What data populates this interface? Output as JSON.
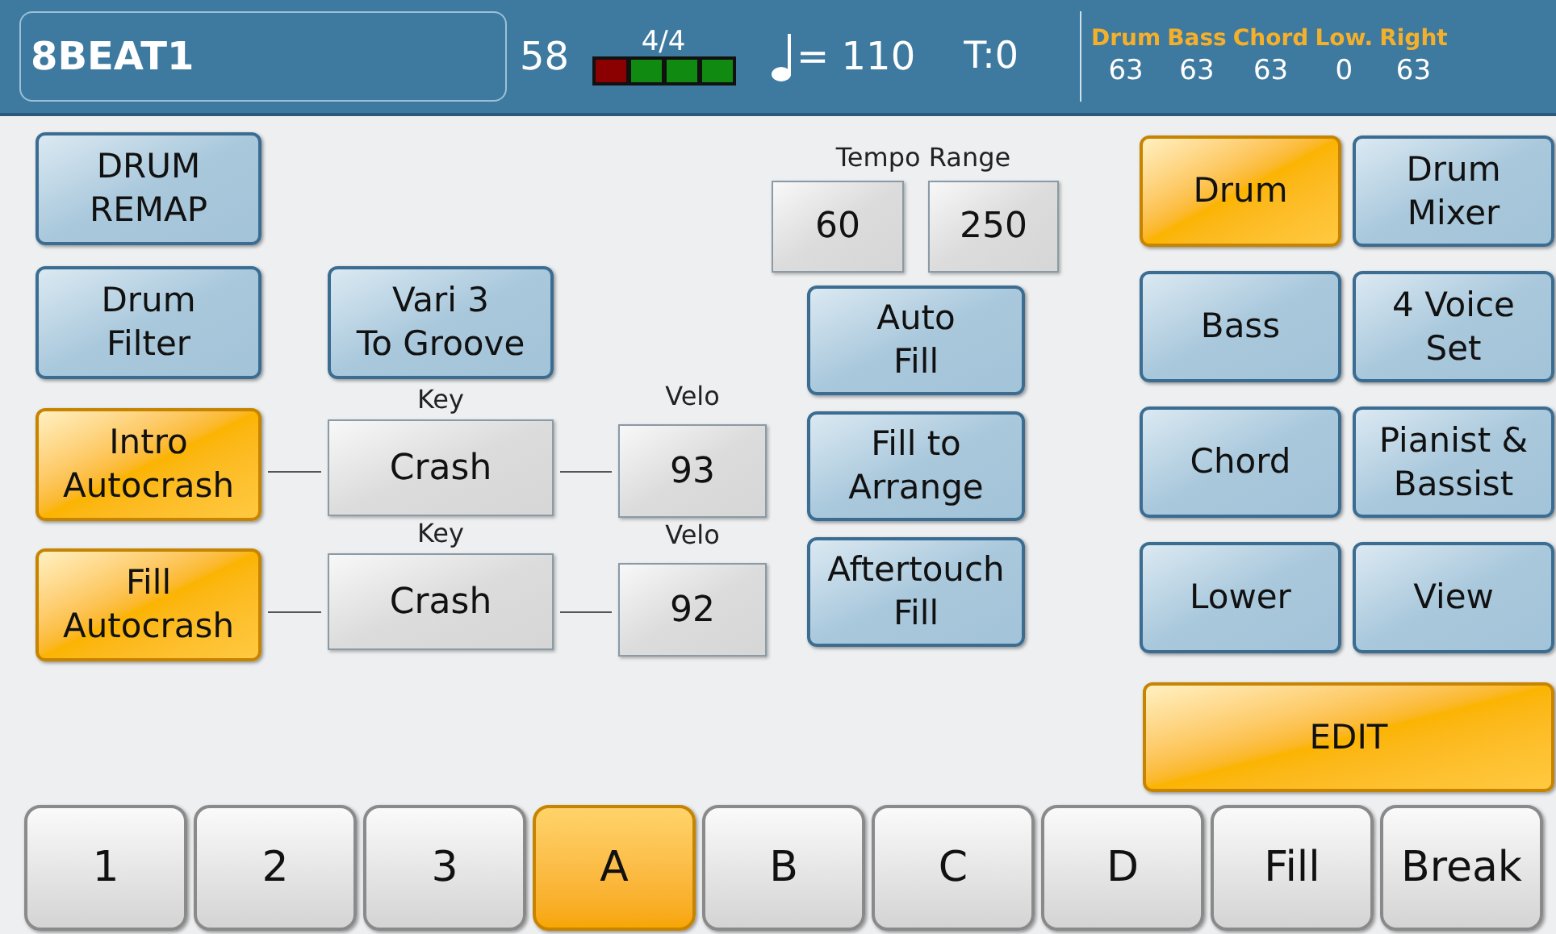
{
  "header": {
    "style_name": "8BEAT1",
    "measure": "58",
    "time_signature": "4/4",
    "beats": [
      {
        "color": "#8b0000"
      },
      {
        "color": "#118a11"
      },
      {
        "color": "#118a11"
      },
      {
        "color": "#118a11"
      }
    ],
    "tempo": "= 110",
    "transpose": "T:0",
    "parts": [
      {
        "label": "Drum",
        "value": "63"
      },
      {
        "label": "Bass",
        "value": "63"
      },
      {
        "label": "Chord",
        "value": "63"
      },
      {
        "label": "Low.",
        "value": "0"
      },
      {
        "label": "Right",
        "value": "63"
      }
    ]
  },
  "left_buttons": [
    {
      "label": "DRUM\nREMAP",
      "on": false
    },
    {
      "label": "Drum\nFilter",
      "on": false
    }
  ],
  "vari_button": {
    "label": "Vari 3\nTo Groove",
    "on": false
  },
  "autocrash": [
    {
      "label": "Intro\nAutocrash",
      "on": true,
      "key_label": "Key",
      "key": "Crash",
      "velo_label": "Velo",
      "velo": "93"
    },
    {
      "label": "Fill\nAutocrash",
      "on": true,
      "key_label": "Key",
      "key": "Crash",
      "velo_label": "Velo",
      "velo": "92"
    }
  ],
  "tempo_range": {
    "label": "Tempo Range",
    "min": "60",
    "max": "250"
  },
  "fill_buttons": [
    {
      "label": "Auto\nFill",
      "on": false
    },
    {
      "label": "Fill to\nArrange",
      "on": false
    },
    {
      "label": "Aftertouch\nFill",
      "on": false
    }
  ],
  "part_buttons": [
    {
      "label": "Drum",
      "selected": true
    },
    {
      "label": "Bass",
      "selected": false
    },
    {
      "label": "Chord",
      "selected": false
    },
    {
      "label": "Lower",
      "selected": false
    },
    {
      "label": "Drum\nMixer",
      "selected": false
    },
    {
      "label": "4 Voice\nSet",
      "selected": false
    },
    {
      "label": "Pianist &\nBassist",
      "selected": false
    },
    {
      "label": "View",
      "selected": false
    }
  ],
  "edit_button": {
    "label": "EDIT",
    "on": true
  },
  "tabs": [
    {
      "label": "1",
      "selected": false
    },
    {
      "label": "2",
      "selected": false
    },
    {
      "label": "3",
      "selected": false
    },
    {
      "label": "A",
      "selected": true
    },
    {
      "label": "B",
      "selected": false
    },
    {
      "label": "C",
      "selected": false
    },
    {
      "label": "D",
      "selected": false
    },
    {
      "label": "Fill",
      "selected": false
    },
    {
      "label": "Break",
      "selected": false
    }
  ]
}
